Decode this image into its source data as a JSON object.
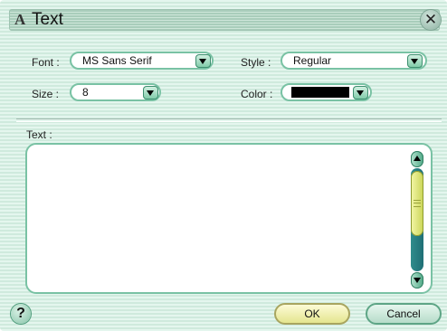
{
  "dialog": {
    "title": "Text",
    "title_icon": "text-a-icon",
    "close_glyph": "✕"
  },
  "font": {
    "label": "Font :",
    "value": "MS Sans Serif"
  },
  "style": {
    "label": "Style :",
    "value": "Regular"
  },
  "size": {
    "label": "Size :",
    "value": "8"
  },
  "color": {
    "label": "Color :",
    "value_hex": "#000000"
  },
  "text_area": {
    "label": "Text :",
    "value": ""
  },
  "buttons": {
    "help": "?",
    "ok": "OK",
    "cancel": "Cancel"
  },
  "theme": {
    "accent": "#79c2a4",
    "background": "#d8f0e4"
  }
}
